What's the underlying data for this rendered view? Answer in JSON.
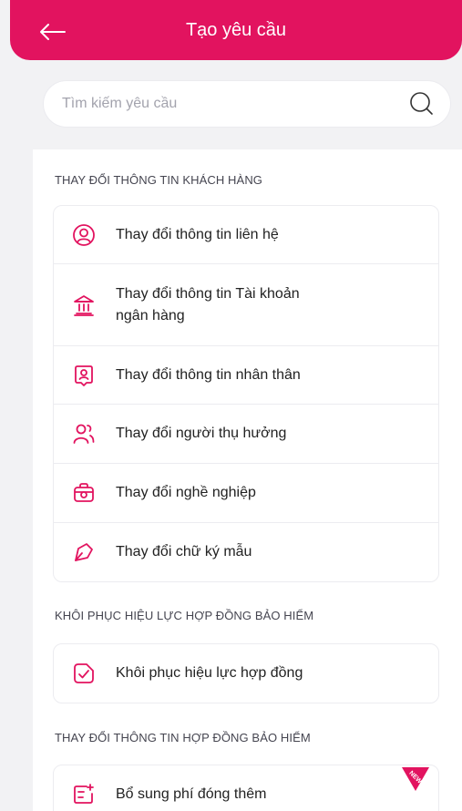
{
  "header": {
    "title": "Tạo yêu cầu",
    "back_icon": "arrow-left-icon"
  },
  "search": {
    "placeholder": "Tìm kiếm yêu cầu",
    "icon": "search-icon"
  },
  "sections": [
    {
      "title": "THAY ĐỔI THÔNG TIN KHÁCH HÀNG",
      "items": [
        {
          "label": "Thay đổi thông tin liên hệ",
          "icon": "user-circle-icon"
        },
        {
          "label": "Thay đổi thông tin Tài khoản ngân hàng",
          "icon": "bank-icon"
        },
        {
          "label": "Thay đổi thông tin nhân thân",
          "icon": "id-badge-icon"
        },
        {
          "label": "Thay đổi người thụ hưởng",
          "icon": "users-icon"
        },
        {
          "label": "Thay đổi nghề nghiệp",
          "icon": "briefcase-icon"
        },
        {
          "label": "Thay đổi chữ ký mẫu",
          "icon": "signature-icon"
        }
      ]
    },
    {
      "title": "KHÔI PHỤC HIỆU LỰC HỢP ĐỒNG BẢO HIỂM",
      "items": [
        {
          "label": "Khôi phục hiệu lực hợp đồng",
          "icon": "document-check-icon"
        }
      ]
    },
    {
      "title": "THAY ĐỔI THÔNG TIN HỢP ĐỒNG BẢO HIỂM",
      "items": [
        {
          "label": "Bổ sung phí đóng thêm",
          "icon": "add-fee-icon",
          "badge": "NEW"
        }
      ]
    }
  ],
  "colors": {
    "accent": "#e2135f",
    "background": "#f2f2f4",
    "card_border": "#ececf0"
  }
}
